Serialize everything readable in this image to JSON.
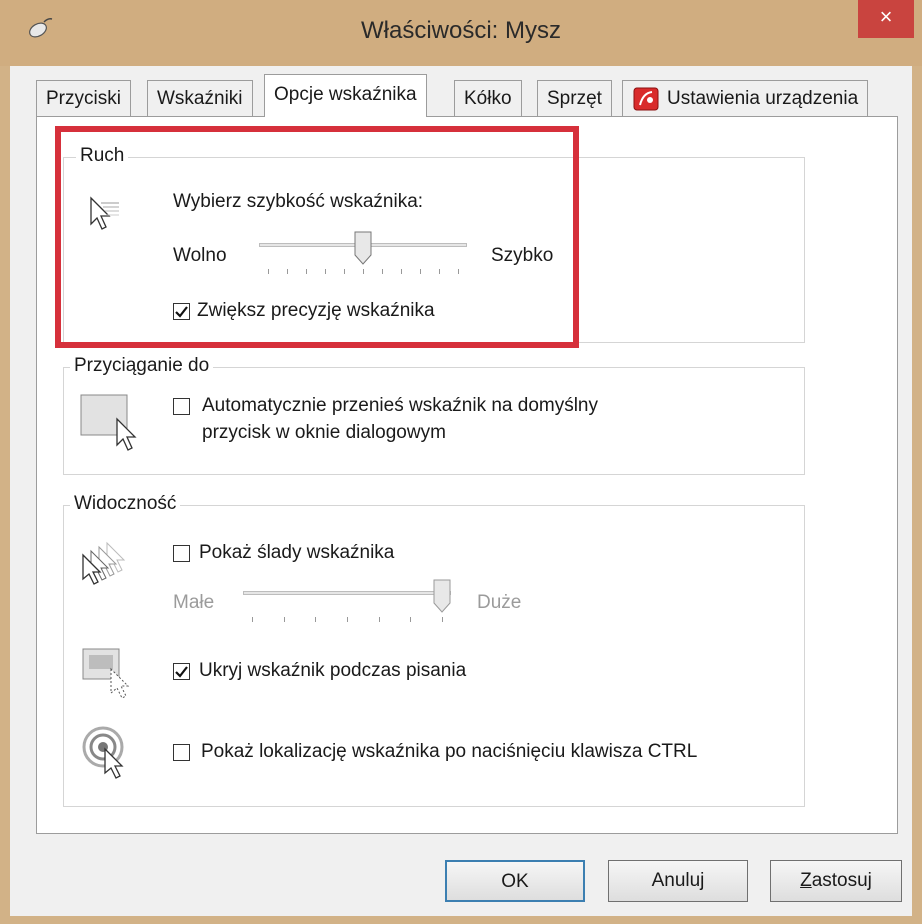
{
  "window": {
    "title": "Właściwości: Mysz",
    "close_label": "×"
  },
  "tabs": [
    {
      "label": "Przyciski"
    },
    {
      "label": "Wskaźniki"
    },
    {
      "label": "Opcje wskaźnika"
    },
    {
      "label": "Kółko"
    },
    {
      "label": "Sprzęt"
    },
    {
      "label": "Ustawienia urządzenia"
    }
  ],
  "active_tab": "Opcje wskaźnika",
  "motion": {
    "group_label": "Ruch",
    "speed_label": "Wybierz szybkość wskaźnika:",
    "slow_label": "Wolno",
    "fast_label": "Szybko",
    "speed_level": 0.5,
    "precision_label": "Zwiększ precyzję wskaźnika",
    "precision_checked": true
  },
  "snap_to": {
    "group_label": "Przyciąganie do",
    "checkbox_line1": "Automatycznie przenieś wskaźnik na domyślny",
    "checkbox_line2": "przycisk w oknie dialogowym",
    "checked": false
  },
  "visibility": {
    "group_label": "Widoczność",
    "trails_label": "Pokaż ślady wskaźnika",
    "trails_checked": false,
    "short_label": "Małe",
    "long_label": "Duże",
    "trails_level": 1.0,
    "hide_typing_label": "Ukryj wskaźnik podczas pisania",
    "hide_typing_checked": true,
    "show_ctrl_label": "Pokaż lokalizację wskaźnika po naciśnięciu klawisza CTRL",
    "show_ctrl_checked": false
  },
  "buttons": {
    "ok": "OK",
    "cancel": "Anuluj",
    "apply": "Zastosuj",
    "apply_underline_char": "Z"
  },
  "colors": {
    "highlight": "#d6303b",
    "close": "#c9443f",
    "titlebar": "#d0ad80"
  }
}
